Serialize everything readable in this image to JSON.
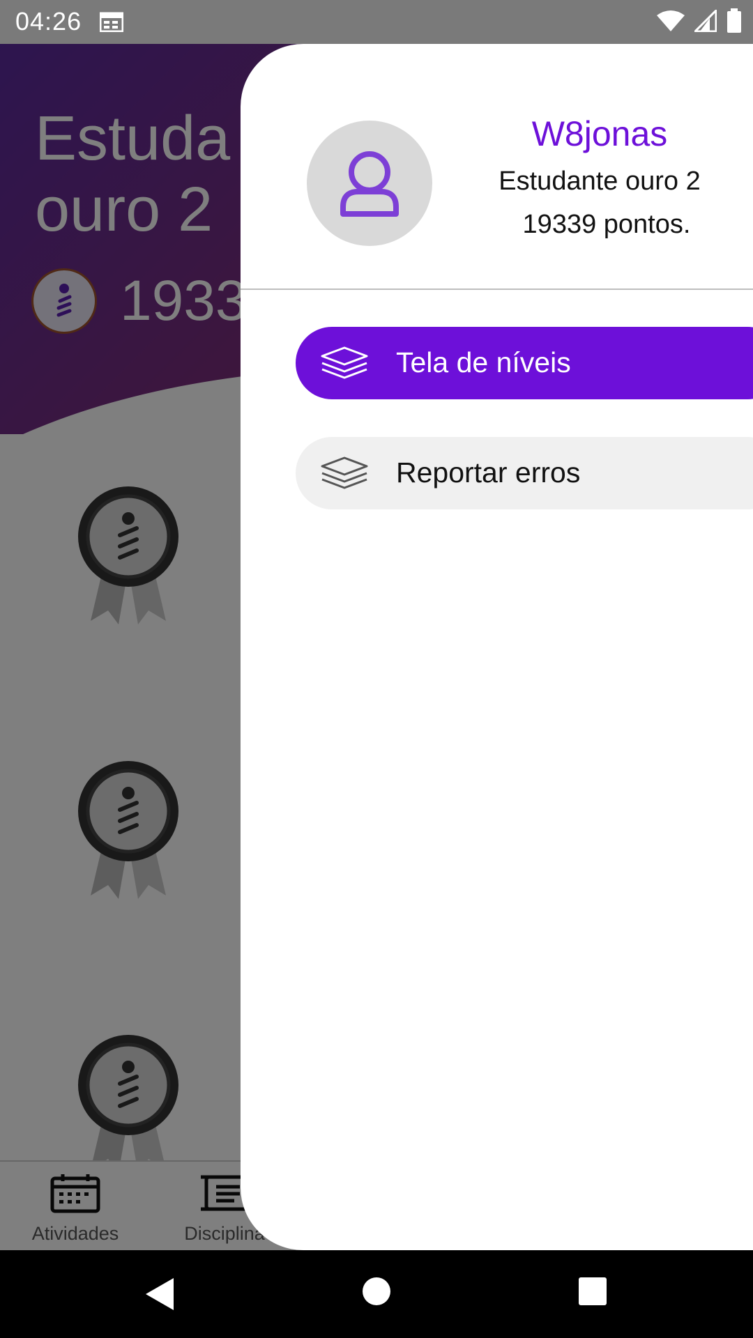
{
  "status_bar": {
    "time": "04:26",
    "icons": [
      "calendar-icon",
      "wifi-icon",
      "signal-icon",
      "battery-icon"
    ]
  },
  "background_screen": {
    "level_title_line1": "Estuda",
    "level_title_line2": "ouro 2",
    "points": "1933",
    "bottom_nav": [
      {
        "label": "Atividades",
        "icon": "calendar-icon"
      },
      {
        "label": "Disciplina",
        "icon": "list-icon"
      }
    ]
  },
  "drawer": {
    "username": "W8jonas",
    "level": "Estudante ouro 2",
    "points": "19339 pontos.",
    "menu": [
      {
        "label": "Tela de níveis",
        "icon": "layers-icon",
        "active": true
      },
      {
        "label": "Reportar erros",
        "icon": "layers-icon",
        "active": false
      }
    ]
  },
  "colors": {
    "accent": "#6d10d9",
    "status_bar": "#7a7a7a",
    "scrim": "rgba(0,0,0,0.5)"
  }
}
